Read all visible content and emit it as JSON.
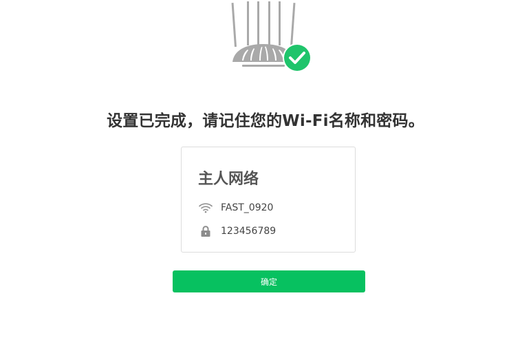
{
  "headline": "设置已完成，请记住您的Wi-Fi名称和密码。",
  "network_card": {
    "title": "主人网络",
    "ssid": "FAST_0920",
    "password": "123456789",
    "ssid_icon": "wifi-icon",
    "password_icon": "lock-icon"
  },
  "confirm_button": {
    "label": "确定"
  },
  "illustration": {
    "router_icon": "router-icon",
    "status_icon": "check-circle-icon"
  },
  "colors": {
    "accent_green": "#07c160",
    "check_green": "#1fc46b",
    "router_gray": "#a9a9a9",
    "text_dark": "#333333",
    "icon_gray": "#8c8c8c"
  }
}
